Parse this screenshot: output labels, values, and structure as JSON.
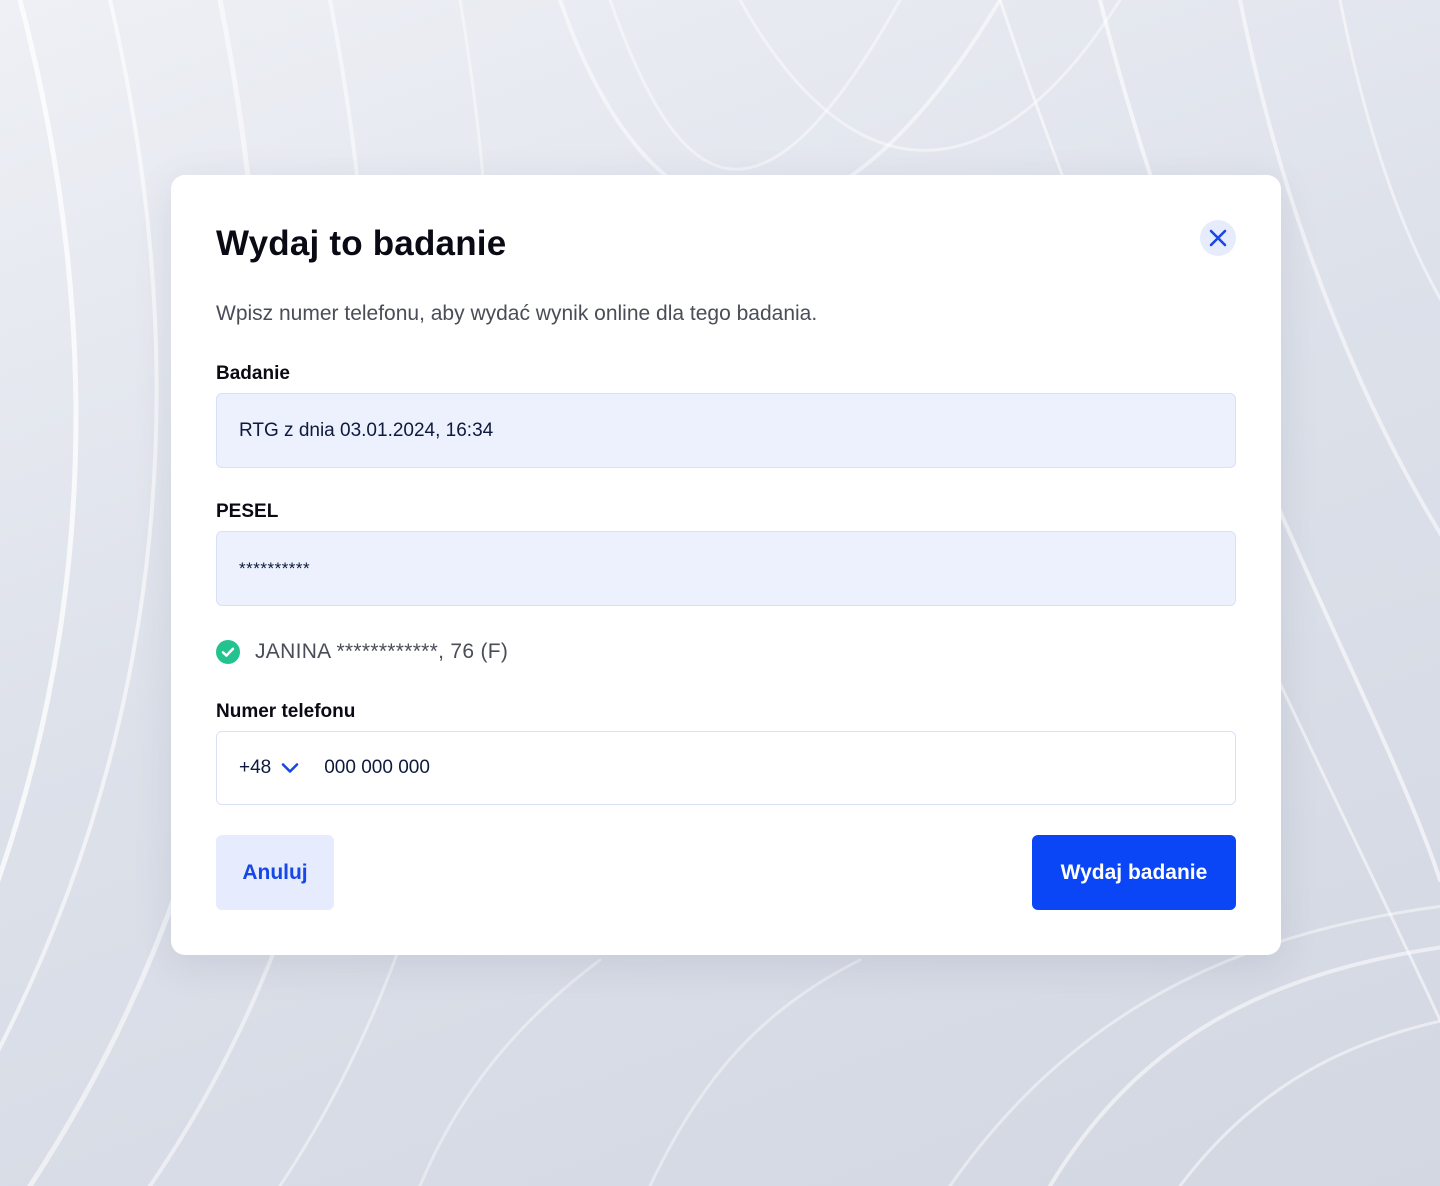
{
  "dialog": {
    "title": "Wydaj to badanie",
    "description": "Wpisz numer telefonu, aby wydać wynik online dla tego badania.",
    "close_icon": "close-icon"
  },
  "exam_field": {
    "label": "Badanie",
    "value": "RTG z dnia 03.01.2024, 16:34"
  },
  "pesel_field": {
    "label": "PESEL",
    "value": "**********"
  },
  "patient_verification": {
    "icon": "check-circle-icon",
    "status_color": "#22c38e",
    "text": "JANINA ************, 76 (F)"
  },
  "phone_field": {
    "label": "Numer telefonu",
    "country_code": "+48",
    "dropdown_icon": "chevron-down-icon",
    "placeholder": "000 000 000"
  },
  "actions": {
    "cancel_label": "Anuluj",
    "submit_label": "Wydaj badanie"
  },
  "colors": {
    "accent": "#0a46f5",
    "accent_soft": "#e6ebfd",
    "field_bg": "#edf1fd"
  }
}
